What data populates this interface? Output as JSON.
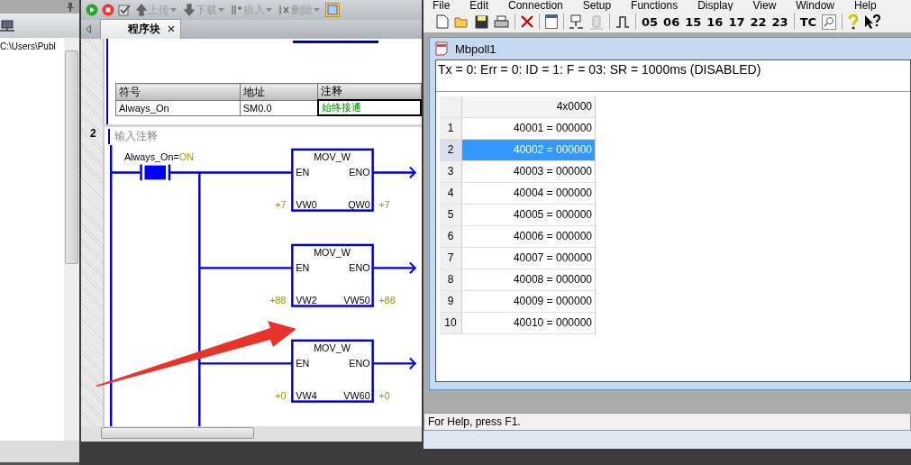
{
  "left_panel": {
    "path": "C:\\Users\\Publ"
  },
  "editor": {
    "toolbar": [
      {
        "label": "上传",
        "disabled": true
      },
      {
        "label": "下载",
        "disabled": true
      },
      {
        "label": "插入",
        "disabled": true
      },
      {
        "label": "删除",
        "disabled": true
      }
    ],
    "tab": {
      "label": "程序块"
    },
    "symbol_table": {
      "columns": [
        "符号",
        "地址",
        "注释"
      ],
      "rows": [
        [
          "Always_On",
          "SM0.0",
          "始终接通"
        ]
      ]
    },
    "network": {
      "number": "2",
      "comment": "输入注释",
      "contact": {
        "label": "Always_On=",
        "state": "ON"
      },
      "blocks": [
        {
          "title": "MOV_W",
          "en": "EN",
          "eno": "ENO",
          "in_value": "+7",
          "in": "VW0",
          "out": "QW0",
          "out_value": "+7"
        },
        {
          "title": "MOV_W",
          "en": "EN",
          "eno": "ENO",
          "in_value": "+88",
          "in": "VW2",
          "out": "VW50",
          "out_value": "+88"
        },
        {
          "title": "MOV_W",
          "en": "EN",
          "eno": "ENO",
          "in_value": "+0",
          "in": "VW4",
          "out": "VW60",
          "out_value": "+0"
        }
      ]
    }
  },
  "mbpoll": {
    "menu": [
      "File",
      "Edit",
      "Connection",
      "Setup",
      "Functions",
      "Display",
      "View",
      "Window",
      "Help"
    ],
    "function_codes": [
      "05",
      "06",
      "15",
      "16",
      "17",
      "22",
      "23"
    ],
    "tc_button": "TC",
    "window": {
      "title": "Mbpoll1",
      "status": "Tx = 0: Err = 0: ID = 1: F = 03: SR = 1000ms  (DISABLED)",
      "table": {
        "header": "4x0000",
        "rows": [
          {
            "index": "1",
            "value": "40001 = 000000",
            "selected": false
          },
          {
            "index": "2",
            "value": "40002 = 000000",
            "selected": true
          },
          {
            "index": "3",
            "value": "40003 = 000000",
            "selected": false
          },
          {
            "index": "4",
            "value": "40004 = 000000",
            "selected": false
          },
          {
            "index": "5",
            "value": "40005 = 000000",
            "selected": false
          },
          {
            "index": "6",
            "value": "40006 = 000000",
            "selected": false
          },
          {
            "index": "7",
            "value": "40007 = 000000",
            "selected": false
          },
          {
            "index": "8",
            "value": "40008 = 000000",
            "selected": false
          },
          {
            "index": "9",
            "value": "40009 = 000000",
            "selected": false
          },
          {
            "index": "10",
            "value": "40010 = 000000",
            "selected": false
          }
        ]
      }
    },
    "status_bar": "For Help, press F1."
  }
}
